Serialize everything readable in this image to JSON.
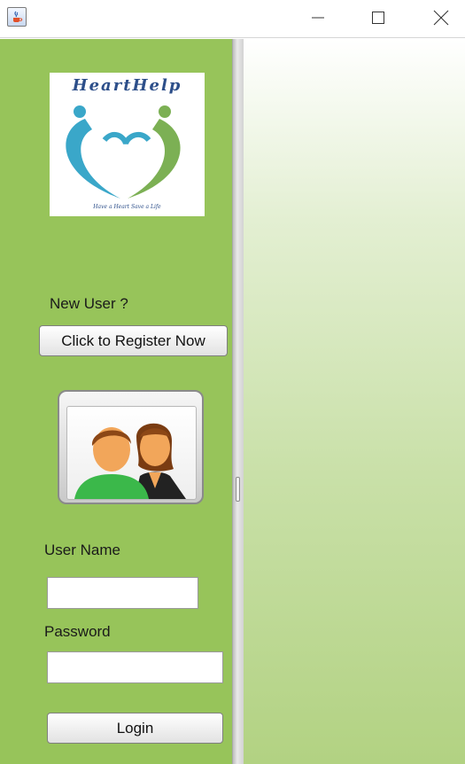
{
  "titlebar": {
    "app_icon": "java-cup-icon",
    "controls": [
      "minimize-icon",
      "maximize-icon",
      "close-icon"
    ]
  },
  "logo": {
    "title": "HeartHelp",
    "tagline": "Have a Heart Save a Life",
    "colors": {
      "blue": "#3aa7c9",
      "green": "#7cb054",
      "text": "#2d4f8a"
    }
  },
  "register": {
    "prompt": "New User ?",
    "button_label": "Click to Register Now"
  },
  "login": {
    "avatar_icon": "users-icon",
    "username_label": "User Name",
    "username_value": "",
    "password_label": "Password",
    "password_value": "",
    "button_label": "Login"
  },
  "colors": {
    "left_panel": "#97c45a",
    "right_gradient_top": "#ffffff",
    "right_gradient_bottom": "#b2d282"
  }
}
